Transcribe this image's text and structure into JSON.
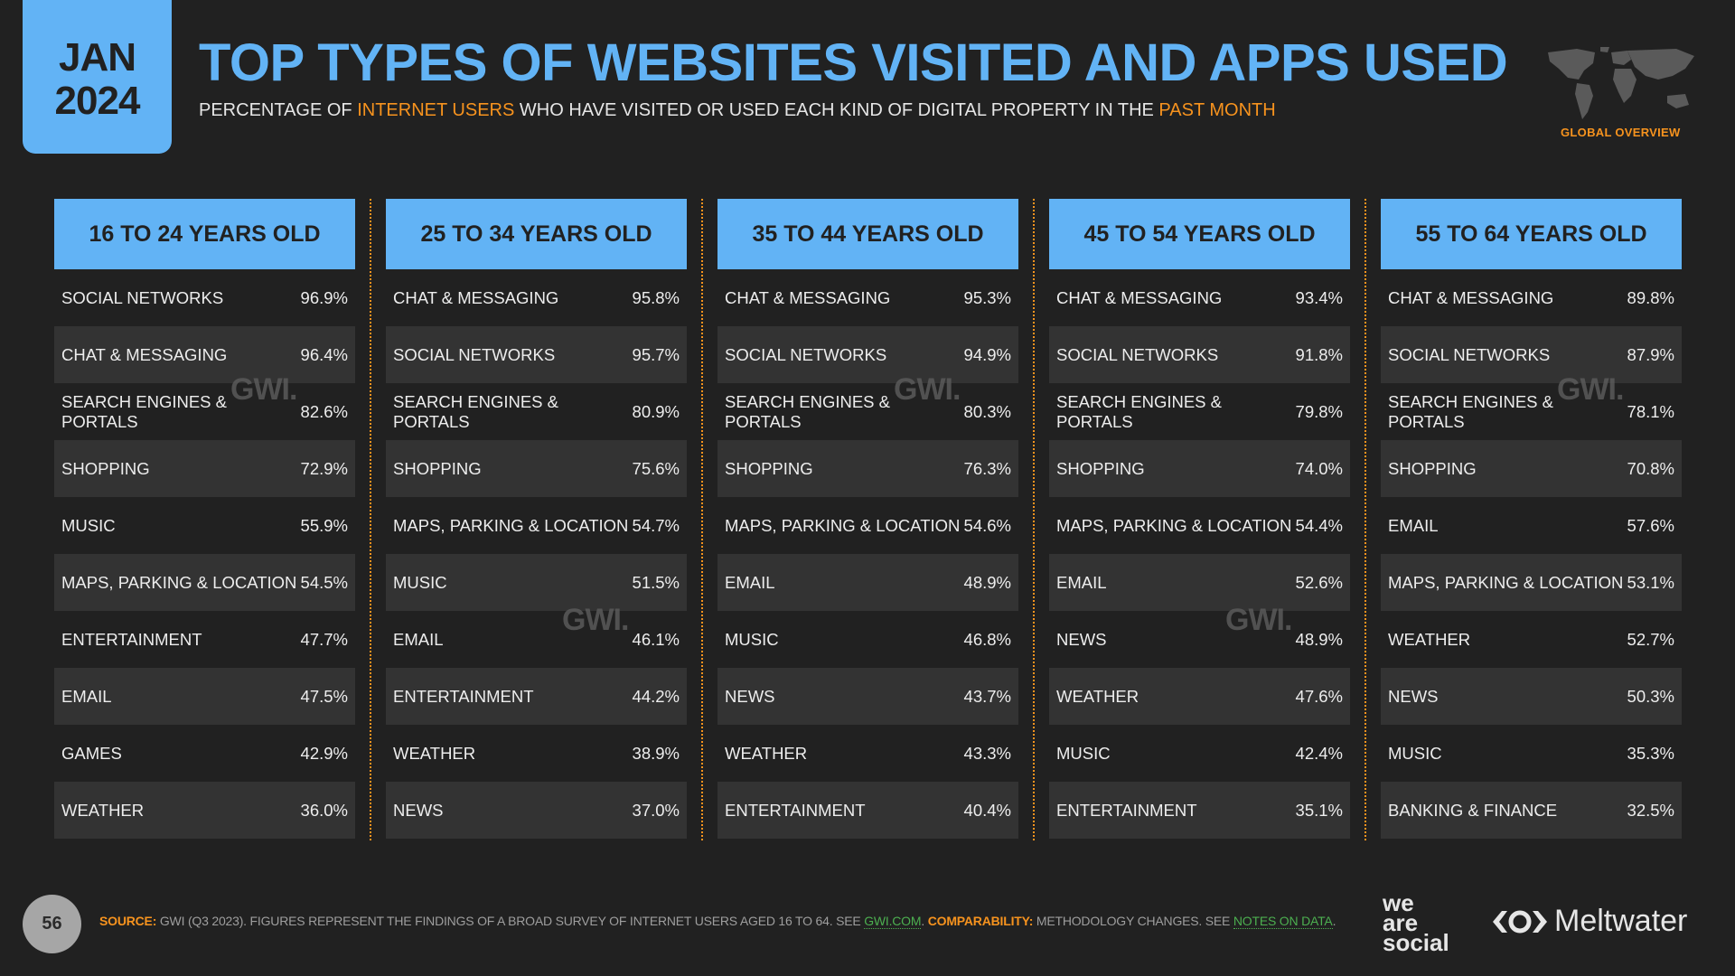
{
  "date_tab": {
    "month": "JAN",
    "year": "2024"
  },
  "header": {
    "title": "TOP TYPES OF WEBSITES VISITED AND APPS USED",
    "subtitle_parts": [
      {
        "text": "PERCENTAGE OF ",
        "highlight": false
      },
      {
        "text": "INTERNET USERS",
        "highlight": true
      },
      {
        "text": " WHO HAVE VISITED OR USED EACH KIND OF DIGITAL PROPERTY IN THE ",
        "highlight": false
      },
      {
        "text": "PAST MONTH",
        "highlight": true
      }
    ],
    "region_label": "GLOBAL OVERVIEW",
    "region_icon": "world-map-icon"
  },
  "colors": {
    "accent": "#62b3f5",
    "highlight": "#f7931e",
    "background": "#212121",
    "row_alt": "#333333",
    "link": "#4caf50"
  },
  "watermark": "GWI.",
  "chart_data": {
    "type": "table",
    "title": "TOP TYPES OF WEBSITES VISITED AND APPS USED",
    "subtitle": "PERCENTAGE OF INTERNET USERS WHO HAVE VISITED OR USED EACH KIND OF DIGITAL PROPERTY IN THE PAST MONTH",
    "unit": "%",
    "groups": [
      {
        "name": "16 TO 24 YEARS OLD",
        "rows": [
          {
            "label": "SOCIAL NETWORKS",
            "value": 96.9,
            "display": "96.9%"
          },
          {
            "label": "CHAT & MESSAGING",
            "value": 96.4,
            "display": "96.4%"
          },
          {
            "label": "SEARCH ENGINES & PORTALS",
            "value": 82.6,
            "display": "82.6%"
          },
          {
            "label": "SHOPPING",
            "value": 72.9,
            "display": "72.9%"
          },
          {
            "label": "MUSIC",
            "value": 55.9,
            "display": "55.9%"
          },
          {
            "label": "MAPS, PARKING & LOCATION",
            "value": 54.5,
            "display": "54.5%"
          },
          {
            "label": "ENTERTAINMENT",
            "value": 47.7,
            "display": "47.7%"
          },
          {
            "label": "EMAIL",
            "value": 47.5,
            "display": "47.5%"
          },
          {
            "label": "GAMES",
            "value": 42.9,
            "display": "42.9%"
          },
          {
            "label": "WEATHER",
            "value": 36.0,
            "display": "36.0%"
          }
        ]
      },
      {
        "name": "25 TO 34 YEARS OLD",
        "rows": [
          {
            "label": "CHAT & MESSAGING",
            "value": 95.8,
            "display": "95.8%"
          },
          {
            "label": "SOCIAL NETWORKS",
            "value": 95.7,
            "display": "95.7%"
          },
          {
            "label": "SEARCH ENGINES & PORTALS",
            "value": 80.9,
            "display": "80.9%"
          },
          {
            "label": "SHOPPING",
            "value": 75.6,
            "display": "75.6%"
          },
          {
            "label": "MAPS, PARKING & LOCATION",
            "value": 54.7,
            "display": "54.7%"
          },
          {
            "label": "MUSIC",
            "value": 51.5,
            "display": "51.5%"
          },
          {
            "label": "EMAIL",
            "value": 46.1,
            "display": "46.1%"
          },
          {
            "label": "ENTERTAINMENT",
            "value": 44.2,
            "display": "44.2%"
          },
          {
            "label": "WEATHER",
            "value": 38.9,
            "display": "38.9%"
          },
          {
            "label": "NEWS",
            "value": 37.0,
            "display": "37.0%"
          }
        ]
      },
      {
        "name": "35 TO 44 YEARS OLD",
        "rows": [
          {
            "label": "CHAT & MESSAGING",
            "value": 95.3,
            "display": "95.3%"
          },
          {
            "label": "SOCIAL NETWORKS",
            "value": 94.9,
            "display": "94.9%"
          },
          {
            "label": "SEARCH ENGINES & PORTALS",
            "value": 80.3,
            "display": "80.3%"
          },
          {
            "label": "SHOPPING",
            "value": 76.3,
            "display": "76.3%"
          },
          {
            "label": "MAPS, PARKING & LOCATION",
            "value": 54.6,
            "display": "54.6%"
          },
          {
            "label": "EMAIL",
            "value": 48.9,
            "display": "48.9%"
          },
          {
            "label": "MUSIC",
            "value": 46.8,
            "display": "46.8%"
          },
          {
            "label": "NEWS",
            "value": 43.7,
            "display": "43.7%"
          },
          {
            "label": "WEATHER",
            "value": 43.3,
            "display": "43.3%"
          },
          {
            "label": "ENTERTAINMENT",
            "value": 40.4,
            "display": "40.4%"
          }
        ]
      },
      {
        "name": "45 TO 54 YEARS OLD",
        "rows": [
          {
            "label": "CHAT & MESSAGING",
            "value": 93.4,
            "display": "93.4%"
          },
          {
            "label": "SOCIAL NETWORKS",
            "value": 91.8,
            "display": "91.8%"
          },
          {
            "label": "SEARCH ENGINES & PORTALS",
            "value": 79.8,
            "display": "79.8%"
          },
          {
            "label": "SHOPPING",
            "value": 74.0,
            "display": "74.0%"
          },
          {
            "label": "MAPS, PARKING & LOCATION",
            "value": 54.4,
            "display": "54.4%"
          },
          {
            "label": "EMAIL",
            "value": 52.6,
            "display": "52.6%"
          },
          {
            "label": "NEWS",
            "value": 48.9,
            "display": "48.9%"
          },
          {
            "label": "WEATHER",
            "value": 47.6,
            "display": "47.6%"
          },
          {
            "label": "MUSIC",
            "value": 42.4,
            "display": "42.4%"
          },
          {
            "label": "ENTERTAINMENT",
            "value": 35.1,
            "display": "35.1%"
          }
        ]
      },
      {
        "name": "55 TO 64 YEARS OLD",
        "rows": [
          {
            "label": "CHAT & MESSAGING",
            "value": 89.8,
            "display": "89.8%"
          },
          {
            "label": "SOCIAL NETWORKS",
            "value": 87.9,
            "display": "87.9%"
          },
          {
            "label": "SEARCH ENGINES & PORTALS",
            "value": 78.1,
            "display": "78.1%"
          },
          {
            "label": "SHOPPING",
            "value": 70.8,
            "display": "70.8%"
          },
          {
            "label": "EMAIL",
            "value": 57.6,
            "display": "57.6%"
          },
          {
            "label": "MAPS, PARKING & LOCATION",
            "value": 53.1,
            "display": "53.1%"
          },
          {
            "label": "WEATHER",
            "value": 52.7,
            "display": "52.7%"
          },
          {
            "label": "NEWS",
            "value": 50.3,
            "display": "50.3%"
          },
          {
            "label": "MUSIC",
            "value": 35.3,
            "display": "35.3%"
          },
          {
            "label": "BANKING & FINANCE",
            "value": 32.5,
            "display": "32.5%"
          }
        ]
      }
    ]
  },
  "footer": {
    "page_number": "56",
    "source_label": "SOURCE:",
    "source_text": " GWI (Q3 2023). FIGURES REPRESENT THE FINDINGS OF A BROAD SURVEY OF INTERNET USERS AGED 16 TO 64. SEE ",
    "source_link": "GWI.COM",
    "sep": ". ",
    "comparability_label": "COMPARABILITY:",
    "comparability_text": " METHODOLOGY CHANGES. SEE ",
    "comparability_link": "NOTES ON DATA",
    "end": ".",
    "logo_1": [
      "we",
      "are",
      "social"
    ],
    "logo_2": "Meltwater"
  }
}
